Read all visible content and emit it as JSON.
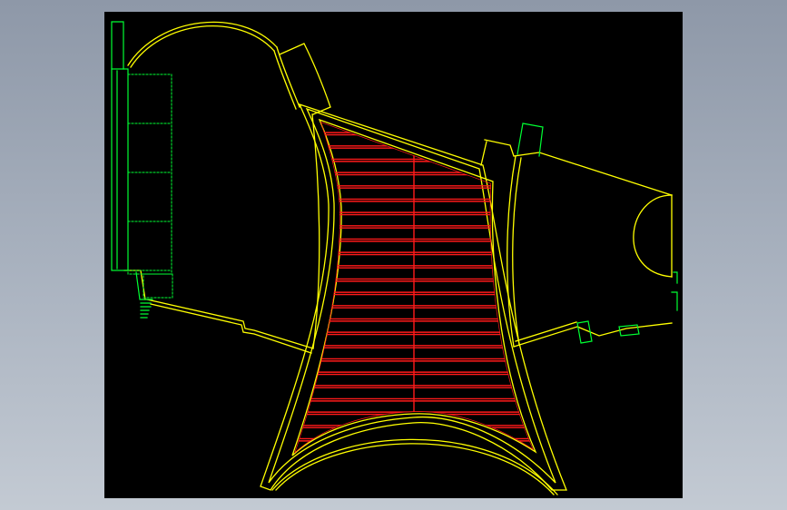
{
  "colors": {
    "background": "#000000",
    "wall": "#ffff00",
    "fixture": "#00ff00",
    "hatch": "#ff0000",
    "outside": "#a0a8b4"
  },
  "layers": {
    "walls": "wall",
    "fixtures": "fixture",
    "hatch": "hatch"
  },
  "hatch_rows": 24
}
